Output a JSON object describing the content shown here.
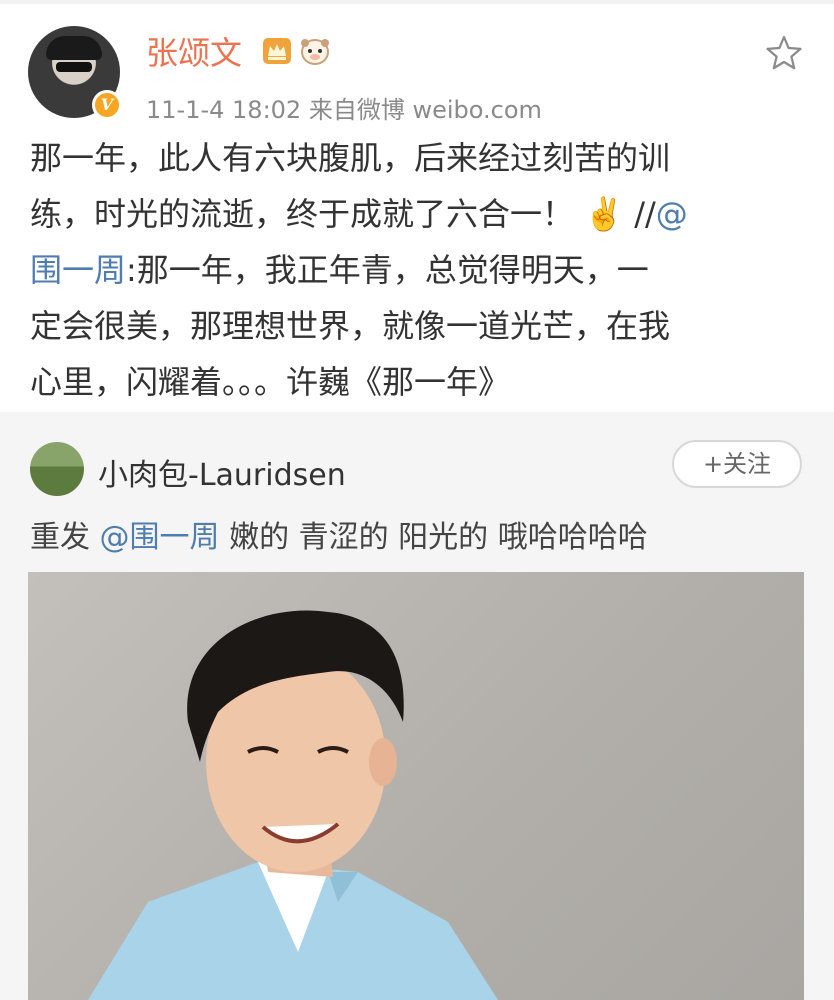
{
  "post": {
    "username": "张颂文",
    "timestamp": "11-1-4 18:02  来自微博 weibo.com",
    "text_line1": "那一年，此人有六块腹肌，后来经过刻苦的训",
    "text_line2": "练，时光的流逝，终于成就了六合一！ ✌️ //",
    "mention_at": "@",
    "mention_name": "围一周",
    "text_line3": ":那一年，我正年青，总觉得明天，一",
    "text_line4": "定会很美，那理想世界，就像一道光芒，在我",
    "text_line5": "心里，闪耀着。。。许巍《那一年》",
    "verified_mark": "V"
  },
  "repost": {
    "username": "小肉包-Lauridsen",
    "follow_label": "+关注",
    "prefix": "重发 ",
    "mention": "@围一周",
    "text": " 嫩的 青涩的 阳光的 哦哈哈哈哈"
  },
  "icons": [
    "crown-icon",
    "face-icon",
    "star-icon",
    "verified-icon"
  ],
  "colors": {
    "username": "#eb7350",
    "mention": "#507daf",
    "repost_bg": "#f5f5f5"
  }
}
